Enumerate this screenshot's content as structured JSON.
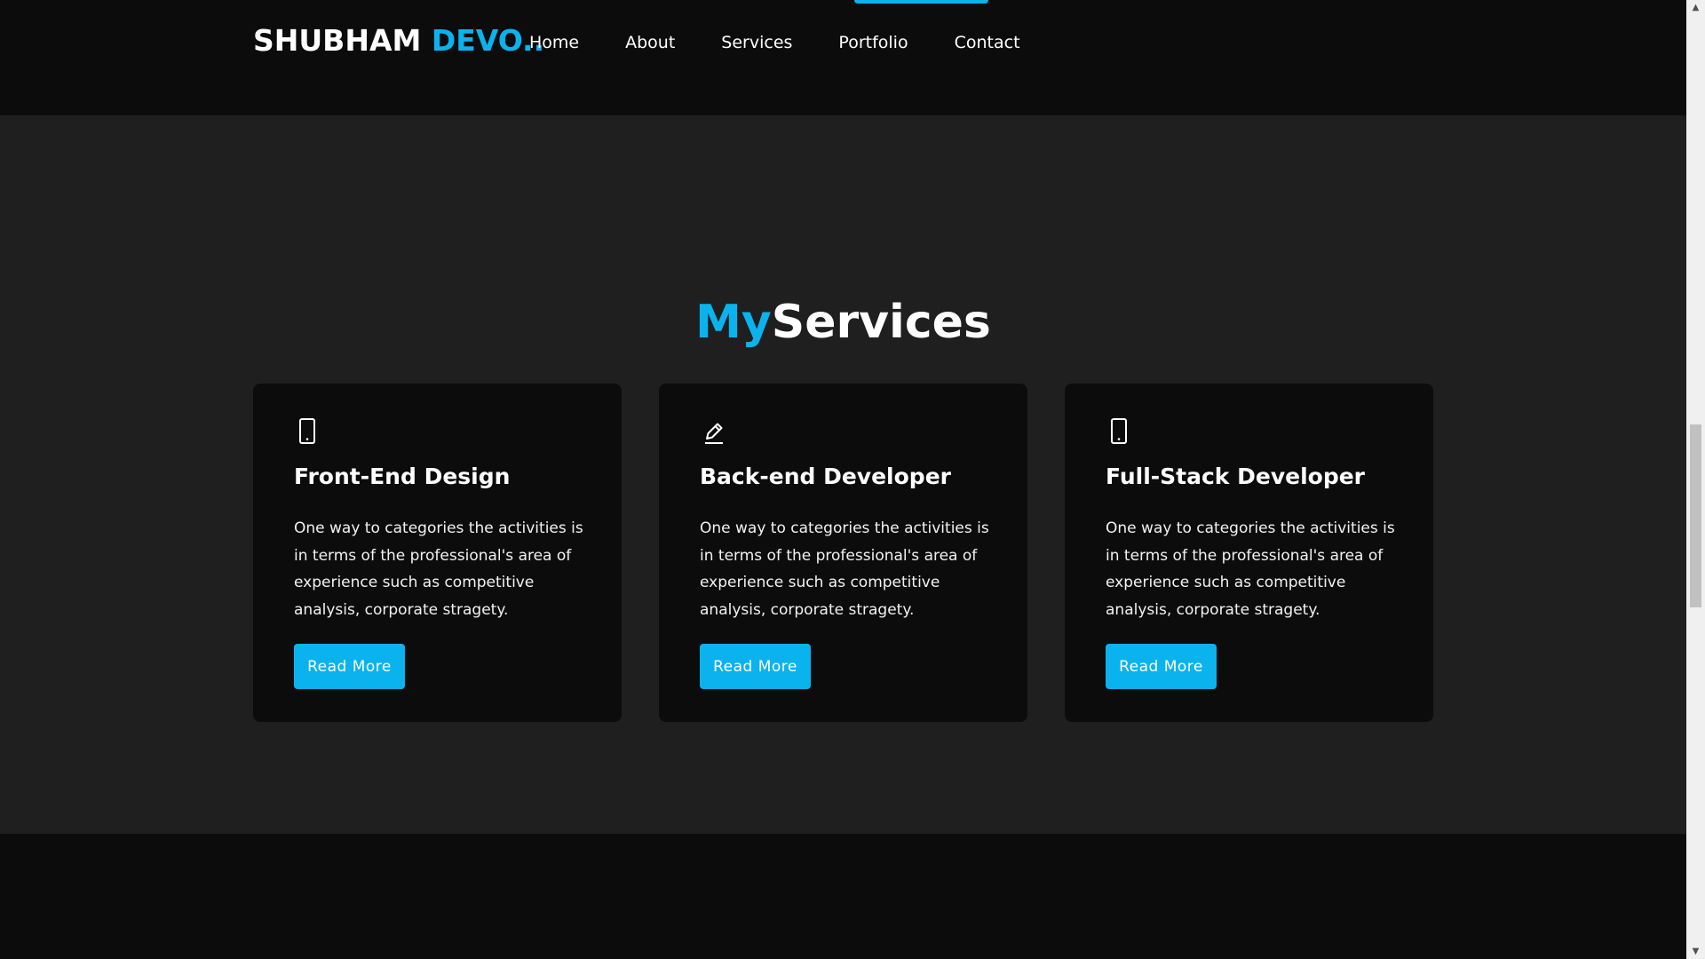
{
  "header": {
    "logo_main": "SHUBHAM ",
    "logo_accent": "DEVO..",
    "nav": [
      "Home",
      "About",
      "Services",
      "Portfolio",
      "Contact"
    ]
  },
  "services": {
    "title_accent": "My",
    "title_main": "Services",
    "cards": [
      {
        "icon": "mobile-icon",
        "title": "Front-End Design",
        "text": "One way to categories the activities is in terms of the professional's area of experience such as competitive analysis, corporate stragety.",
        "button": "Read More"
      },
      {
        "icon": "pencil-icon",
        "title": "Back-end Developer",
        "text": "One way to categories the activities is in terms of the professional's area of experience such as competitive analysis, corporate stragety.",
        "button": "Read More"
      },
      {
        "icon": "mobile-icon",
        "title": "Full-Stack Developer",
        "text": "One way to categories the activities is in terms of the professional's area of experience such as competitive analysis, corporate stragety.",
        "button": "Read More"
      }
    ]
  },
  "colors": {
    "accent": "#0ab3ee",
    "background_dark": "#0c0c0c",
    "section_background": "#1f1f1f"
  }
}
